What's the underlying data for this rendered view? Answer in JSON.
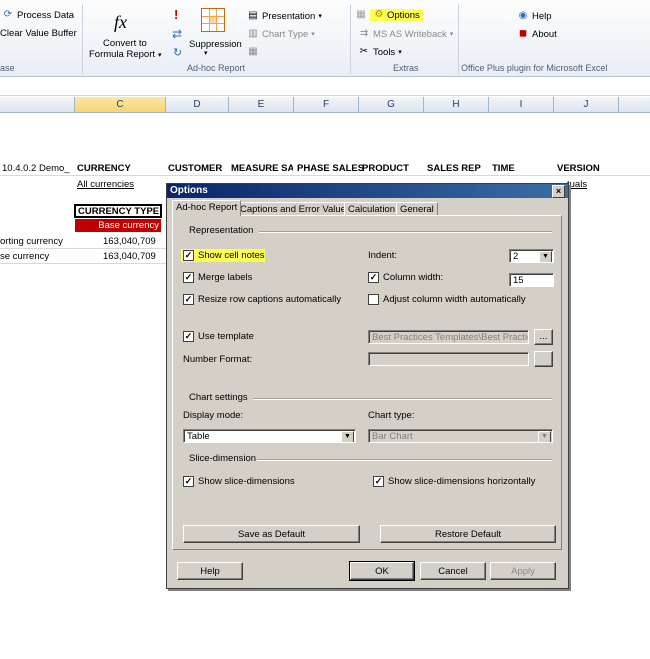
{
  "ribbon": {
    "process_data": "Process Data",
    "clear_value_buffer": "Clear Value Buffer",
    "left_group_label": "ase",
    "convert_to": "Convert to",
    "formula_report": "Formula Report",
    "suppression": "Suppression",
    "presentation": "Presentation",
    "chart_type": "Chart Type",
    "adhoc_group_label": "Ad-hoc Report",
    "options": "Options",
    "ms_as_writeback": "MS AS Writeback",
    "tools": "Tools",
    "extras_group_label": "Extras",
    "help": "Help",
    "about": "About",
    "office_plus_label": "Office Plus plugin for Microsoft Excel"
  },
  "columns": [
    "C",
    "D",
    "E",
    "F",
    "G",
    "H",
    "I",
    "J"
  ],
  "sheet": {
    "row1": [
      "10.4.0.2 Demo_",
      "CURRENCY",
      "CUSTOMER",
      "MEASURE SAL",
      "PHASE SALES",
      "PRODUCT",
      "SALES REP",
      "TIME",
      "VERSION"
    ],
    "all_currencies": "All currencies",
    "actuals": "tuals",
    "currency_type": "CURRENCY TYPE",
    "base_currency": "Base currency",
    "row_reporting": "orting currency",
    "row_reporting_value": "163,040,709",
    "row_base": "se currency",
    "row_base_value": "163,040,709"
  },
  "dialog": {
    "title": "Options",
    "tabs": [
      "Ad-hoc Report",
      "Captions and Error Values",
      "Calculation",
      "General"
    ],
    "representation": "Representation",
    "show_cell_notes": "Show cell notes",
    "merge_labels": "Merge labels",
    "resize_row_captions": "Resize row captions automatically",
    "indent_label": "Indent:",
    "indent_value": "2",
    "column_width_label": "Column width:",
    "column_width_value": "15",
    "adjust_column_width": "Adjust column width automatically",
    "use_template": "Use template",
    "template_path": "Best Practices Templates\\Best Practices",
    "number_format": "Number Format:",
    "chart_settings": "Chart settings",
    "display_mode_label": "Display mode:",
    "display_mode_value": "Table",
    "chart_type_label": "Chart type:",
    "chart_type_value": "Bar Chart",
    "slice_dimension": "Slice-dimension",
    "show_slice_dimensions": "Show slice-dimensions",
    "show_slice_horizontally": "Show slice-dimensions horizontally",
    "save_as_default": "Save as Default",
    "restore_default": "Restore Default",
    "help": "Help",
    "ok": "OK",
    "cancel": "Cancel",
    "apply": "Apply",
    "browse": "...",
    "close": "×",
    "check": "✓"
  },
  "colors": {
    "highlight": "#ffff4f",
    "base_currency_bg": "#c00000",
    "title_bar": "#0a246a"
  }
}
